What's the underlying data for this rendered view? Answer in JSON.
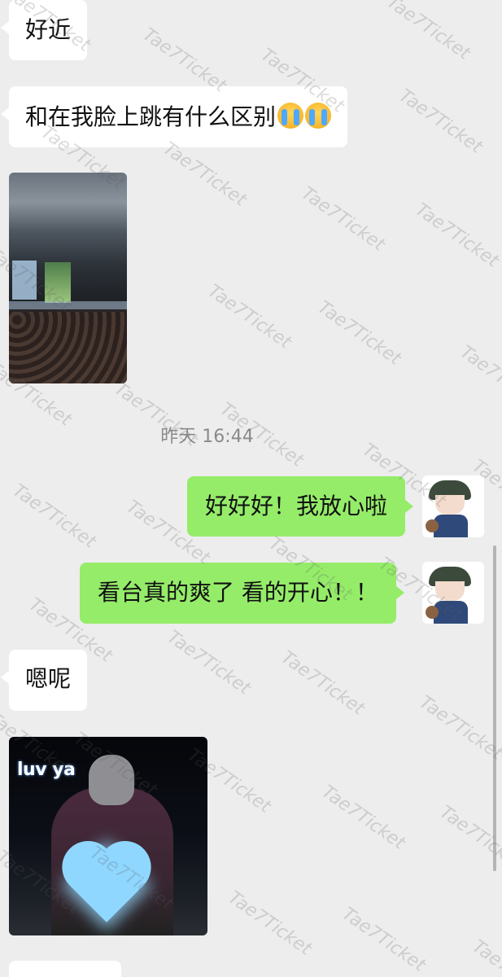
{
  "chat": {
    "messages": [
      {
        "type": "text",
        "direction": "in",
        "text": "好近"
      },
      {
        "type": "text",
        "direction": "in",
        "text": "和在我脸上跳有什么区别",
        "emoji": "crying-face-icon"
      },
      {
        "type": "image",
        "direction": "in",
        "description": "concert-photo"
      },
      {
        "type": "timestamp",
        "text": "昨天 16:44"
      },
      {
        "type": "text",
        "direction": "out",
        "text": "好好好！我放心啦"
      },
      {
        "type": "text",
        "direction": "out",
        "text": "看台真的爽了 看的开心！！"
      },
      {
        "type": "text",
        "direction": "in",
        "text": "嗯呢"
      },
      {
        "type": "image",
        "direction": "in",
        "overlay_text": "luv ya",
        "description": "selfie-with-heart-sticker"
      }
    ]
  },
  "watermark_text": "Tae7Ticket",
  "colors": {
    "background": "#ededed",
    "bubble_in": "#ffffff",
    "bubble_out": "#95ec69",
    "timestamp": "#8b8b8b"
  }
}
